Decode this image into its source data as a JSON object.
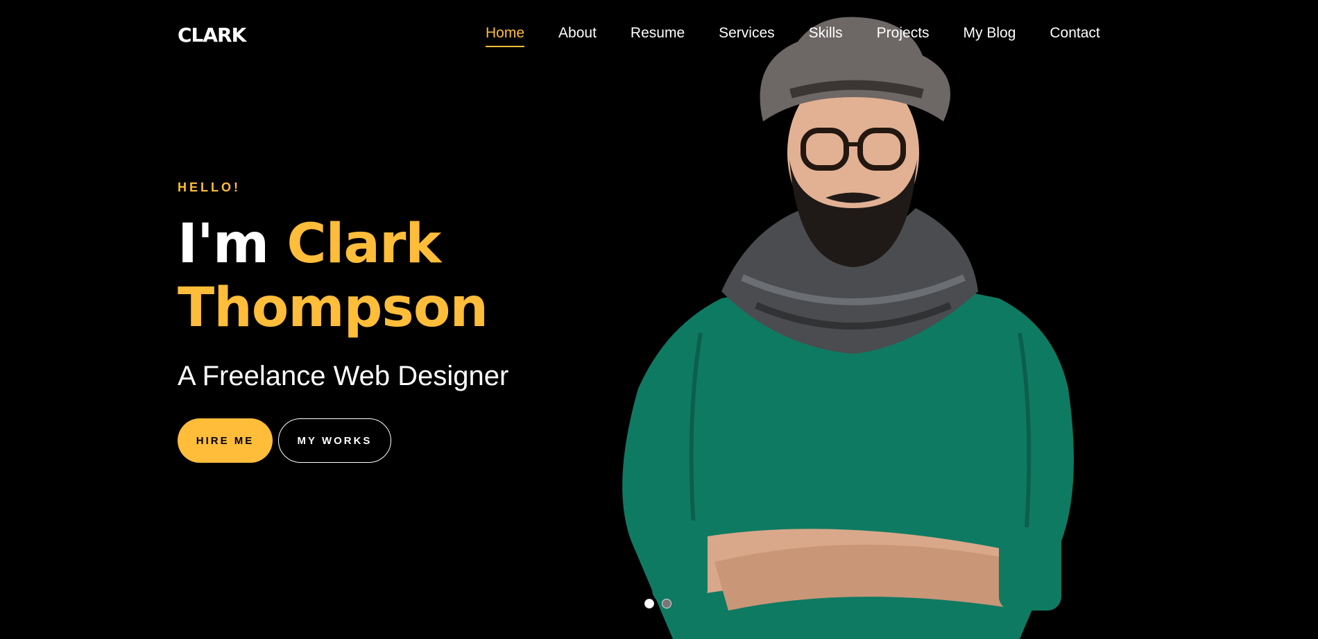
{
  "header": {
    "logo": "CLARK",
    "nav": [
      "Home",
      "About",
      "Resume",
      "Services",
      "Skills",
      "Projects",
      "My Blog",
      "Contact"
    ],
    "active_nav": "Home"
  },
  "hero": {
    "greeting": "HELLO!",
    "title_prefix": "I'm",
    "name_line1": "Clark",
    "name_line2": "Thompson",
    "subtitle": "A Freelance Web Designer",
    "primary_button": "HIRE ME",
    "secondary_button": "MY WORKS"
  },
  "slider": {
    "total": 2,
    "active": 1
  },
  "colors": {
    "background": "#000000",
    "accent": "#ffbd39",
    "text": "#ffffff",
    "sweater": "#0f7a62"
  }
}
